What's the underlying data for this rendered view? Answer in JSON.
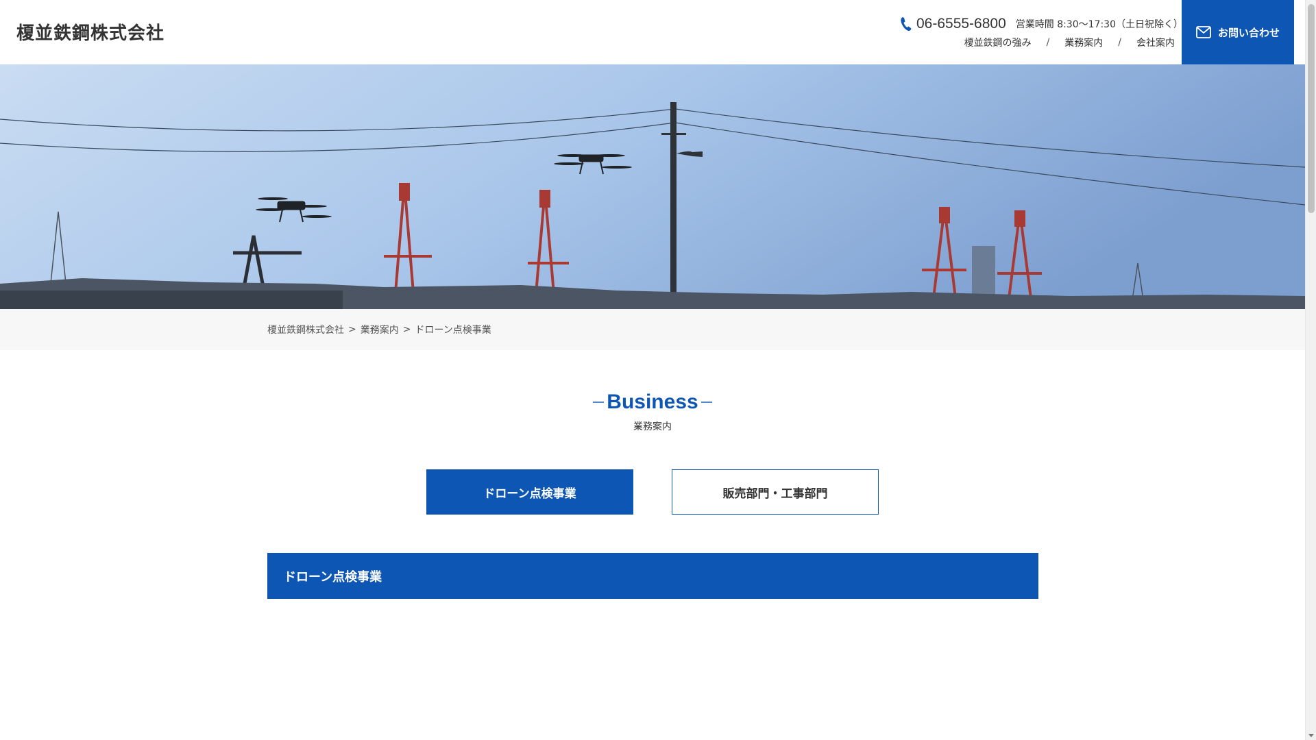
{
  "header": {
    "logo": "榎並鉄鋼株式会社",
    "phone": "06-6555-6800",
    "hours": "営業時間 8:30〜17:30（土日祝除く）",
    "nav": [
      {
        "label": "榎並鉄鋼の強み"
      },
      {
        "label": "業務案内"
      },
      {
        "label": "会社案内"
      }
    ],
    "nav_separator": "/",
    "contact_label": "お問い合わせ"
  },
  "hero": {
    "icons": [
      "drone-icon",
      "drone-icon",
      "crane-icon",
      "utility-pole-icon"
    ]
  },
  "breadcrumb": {
    "items": [
      "榎並鉄鋼株式会社",
      "業務案内",
      "ドローン点検事業"
    ],
    "separator": ">"
  },
  "section": {
    "title_en": "Business",
    "title_jp": "業務案内"
  },
  "tabs": [
    {
      "label": "ドローン点検事業",
      "active": true
    },
    {
      "label": "販売部門・工事部門",
      "active": false
    }
  ],
  "content": {
    "heading": "ドローン点検事業"
  },
  "colors": {
    "brand": "#0d56b4",
    "breadcrumb_bg": "#f7f7f7",
    "text": "#333333"
  }
}
